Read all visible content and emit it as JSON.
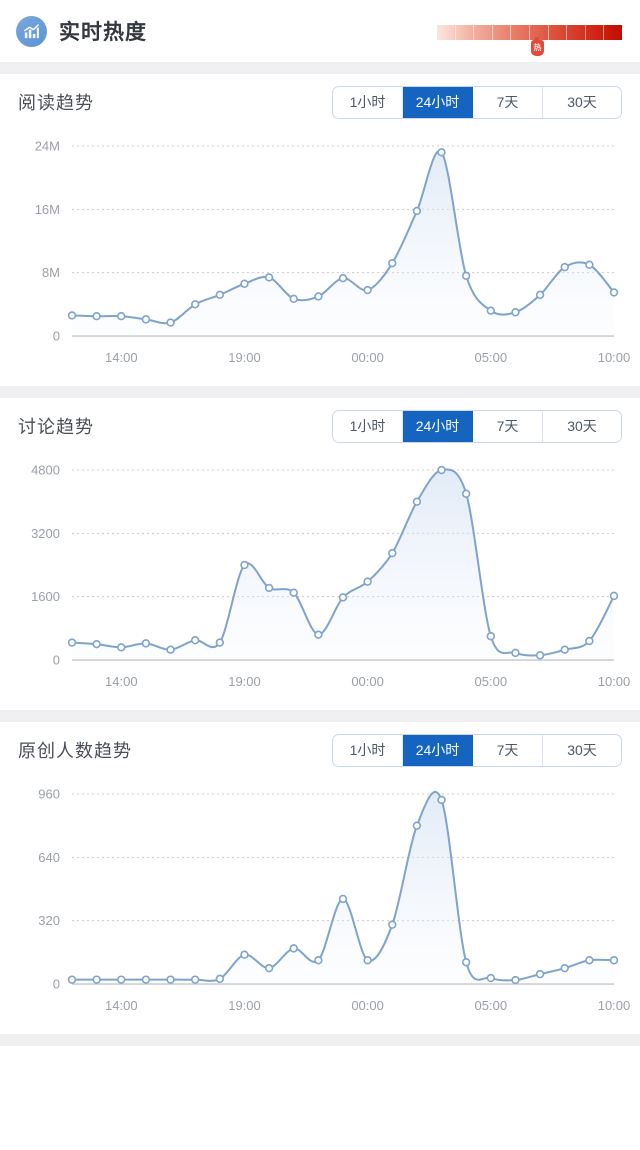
{
  "header": {
    "title": "实时热度",
    "icon": "bar-chart-trend-icon",
    "gauge": {
      "name": "heat-gauge",
      "marker_label": "热",
      "marker_position_pct": 54,
      "tick_count": 10,
      "color_start": "#fbe6e0",
      "color_end": "#c00d00"
    }
  },
  "accent_color": "#1565c0",
  "line_color": "#7fa3cc",
  "range_options": [
    "1小时",
    "24小时",
    "7天",
    "30天"
  ],
  "selected_range": "24小时",
  "sections": [
    {
      "title": "阅读趋势",
      "chart_data": {
        "type": "area",
        "title": "阅读趋势",
        "xlabel": "",
        "ylabel": "",
        "grid": true,
        "legend": "none",
        "ylim": [
          0,
          24000000
        ],
        "yticks": [
          0,
          8000000,
          16000000,
          24000000
        ],
        "ytick_labels": [
          "0",
          "8M",
          "16M",
          "24M"
        ],
        "xtick_labels": [
          "14:00",
          "19:00",
          "00:00",
          "05:00",
          "10:00"
        ],
        "xtick_indices": [
          2,
          7,
          12,
          17,
          22
        ],
        "x": [
          "12:00",
          "13:00",
          "14:00",
          "15:00",
          "16:00",
          "17:00",
          "18:00",
          "19:00",
          "20:00",
          "21:00",
          "22:00",
          "23:00",
          "00:00",
          "01:00",
          "02:00",
          "03:00",
          "04:00",
          "05:00",
          "06:00",
          "07:00",
          "08:00",
          "09:00",
          "10:00"
        ],
        "values": [
          2600000,
          2500000,
          2500000,
          2100000,
          1700000,
          4000000,
          5200000,
          6600000,
          7400000,
          4700000,
          5000000,
          7300000,
          5800000,
          9200000,
          15800000,
          23200000,
          7600000,
          3200000,
          3000000,
          5200000,
          8700000,
          9000000,
          5500000
        ]
      }
    },
    {
      "title": "讨论趋势",
      "chart_data": {
        "type": "area",
        "title": "讨论趋势",
        "xlabel": "",
        "ylabel": "",
        "grid": true,
        "legend": "none",
        "ylim": [
          0,
          4800
        ],
        "yticks": [
          0,
          1600,
          3200,
          4800
        ],
        "ytick_labels": [
          "0",
          "1600",
          "3200",
          "4800"
        ],
        "xtick_labels": [
          "14:00",
          "19:00",
          "00:00",
          "05:00",
          "10:00"
        ],
        "xtick_indices": [
          2,
          7,
          12,
          17,
          22
        ],
        "x": [
          "12:00",
          "13:00",
          "14:00",
          "15:00",
          "16:00",
          "17:00",
          "18:00",
          "19:00",
          "20:00",
          "21:00",
          "22:00",
          "23:00",
          "00:00",
          "01:00",
          "02:00",
          "03:00",
          "04:00",
          "05:00",
          "06:00",
          "07:00",
          "08:00",
          "09:00",
          "10:00"
        ],
        "values": [
          440,
          400,
          320,
          420,
          260,
          500,
          440,
          2400,
          1820,
          1700,
          640,
          1580,
          1980,
          2700,
          4000,
          4800,
          4200,
          600,
          180,
          120,
          260,
          480,
          1620
        ]
      }
    },
    {
      "title": "原创人数趋势",
      "chart_data": {
        "type": "area",
        "title": "原创人数趋势",
        "xlabel": "",
        "ylabel": "",
        "grid": true,
        "legend": "none",
        "ylim": [
          0,
          960
        ],
        "yticks": [
          0,
          320,
          640,
          960
        ],
        "ytick_labels": [
          "0",
          "320",
          "640",
          "960"
        ],
        "xtick_labels": [
          "14:00",
          "19:00",
          "00:00",
          "05:00",
          "10:00"
        ],
        "xtick_indices": [
          2,
          7,
          12,
          17,
          22
        ],
        "x": [
          "12:00",
          "13:00",
          "14:00",
          "15:00",
          "16:00",
          "17:00",
          "18:00",
          "19:00",
          "20:00",
          "21:00",
          "22:00",
          "23:00",
          "00:00",
          "01:00",
          "02:00",
          "03:00",
          "04:00",
          "05:00",
          "06:00",
          "07:00",
          "08:00",
          "09:00",
          "10:00"
        ],
        "values": [
          22,
          22,
          22,
          22,
          22,
          22,
          26,
          148,
          80,
          180,
          120,
          430,
          120,
          300,
          800,
          930,
          110,
          30,
          20,
          50,
          80,
          120,
          120
        ]
      }
    }
  ]
}
